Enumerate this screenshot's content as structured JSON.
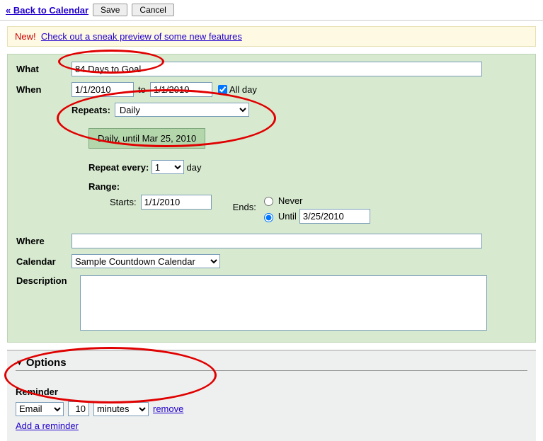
{
  "topbar": {
    "back_label": "« Back to Calendar",
    "save_label": "Save",
    "cancel_label": "Cancel"
  },
  "notice": {
    "new_tag": "New!",
    "link_text": "Check out a sneak preview of some new features"
  },
  "event": {
    "what_label": "What",
    "what_value": "84 Days to Goal",
    "when_label": "When",
    "start_date": "1/1/2010",
    "to_label": "to",
    "end_date": "1/1/2010",
    "all_day_label": "All day",
    "all_day_checked": true,
    "repeat": {
      "label": "Repeats:",
      "value": "Daily",
      "summary": "Daily, until Mar 25, 2010",
      "every_label": "Repeat every:",
      "every_value": "1",
      "every_unit": "day",
      "range_label": "Range:",
      "starts_label": "Starts:",
      "starts_value": "1/1/2010",
      "ends_label": "Ends:",
      "never_label": "Never",
      "until_label": "Until",
      "until_value": "3/25/2010",
      "ends_selected": "until"
    },
    "where_label": "Where",
    "where_value": "",
    "calendar_label": "Calendar",
    "calendar_value": "Sample Countdown Calendar",
    "description_label": "Description",
    "description_value": ""
  },
  "options": {
    "header": "Options",
    "reminder_label": "Reminder",
    "method": "Email",
    "amount": "10",
    "unit": "minutes",
    "remove_label": "remove",
    "add_label": "Add a reminder"
  }
}
